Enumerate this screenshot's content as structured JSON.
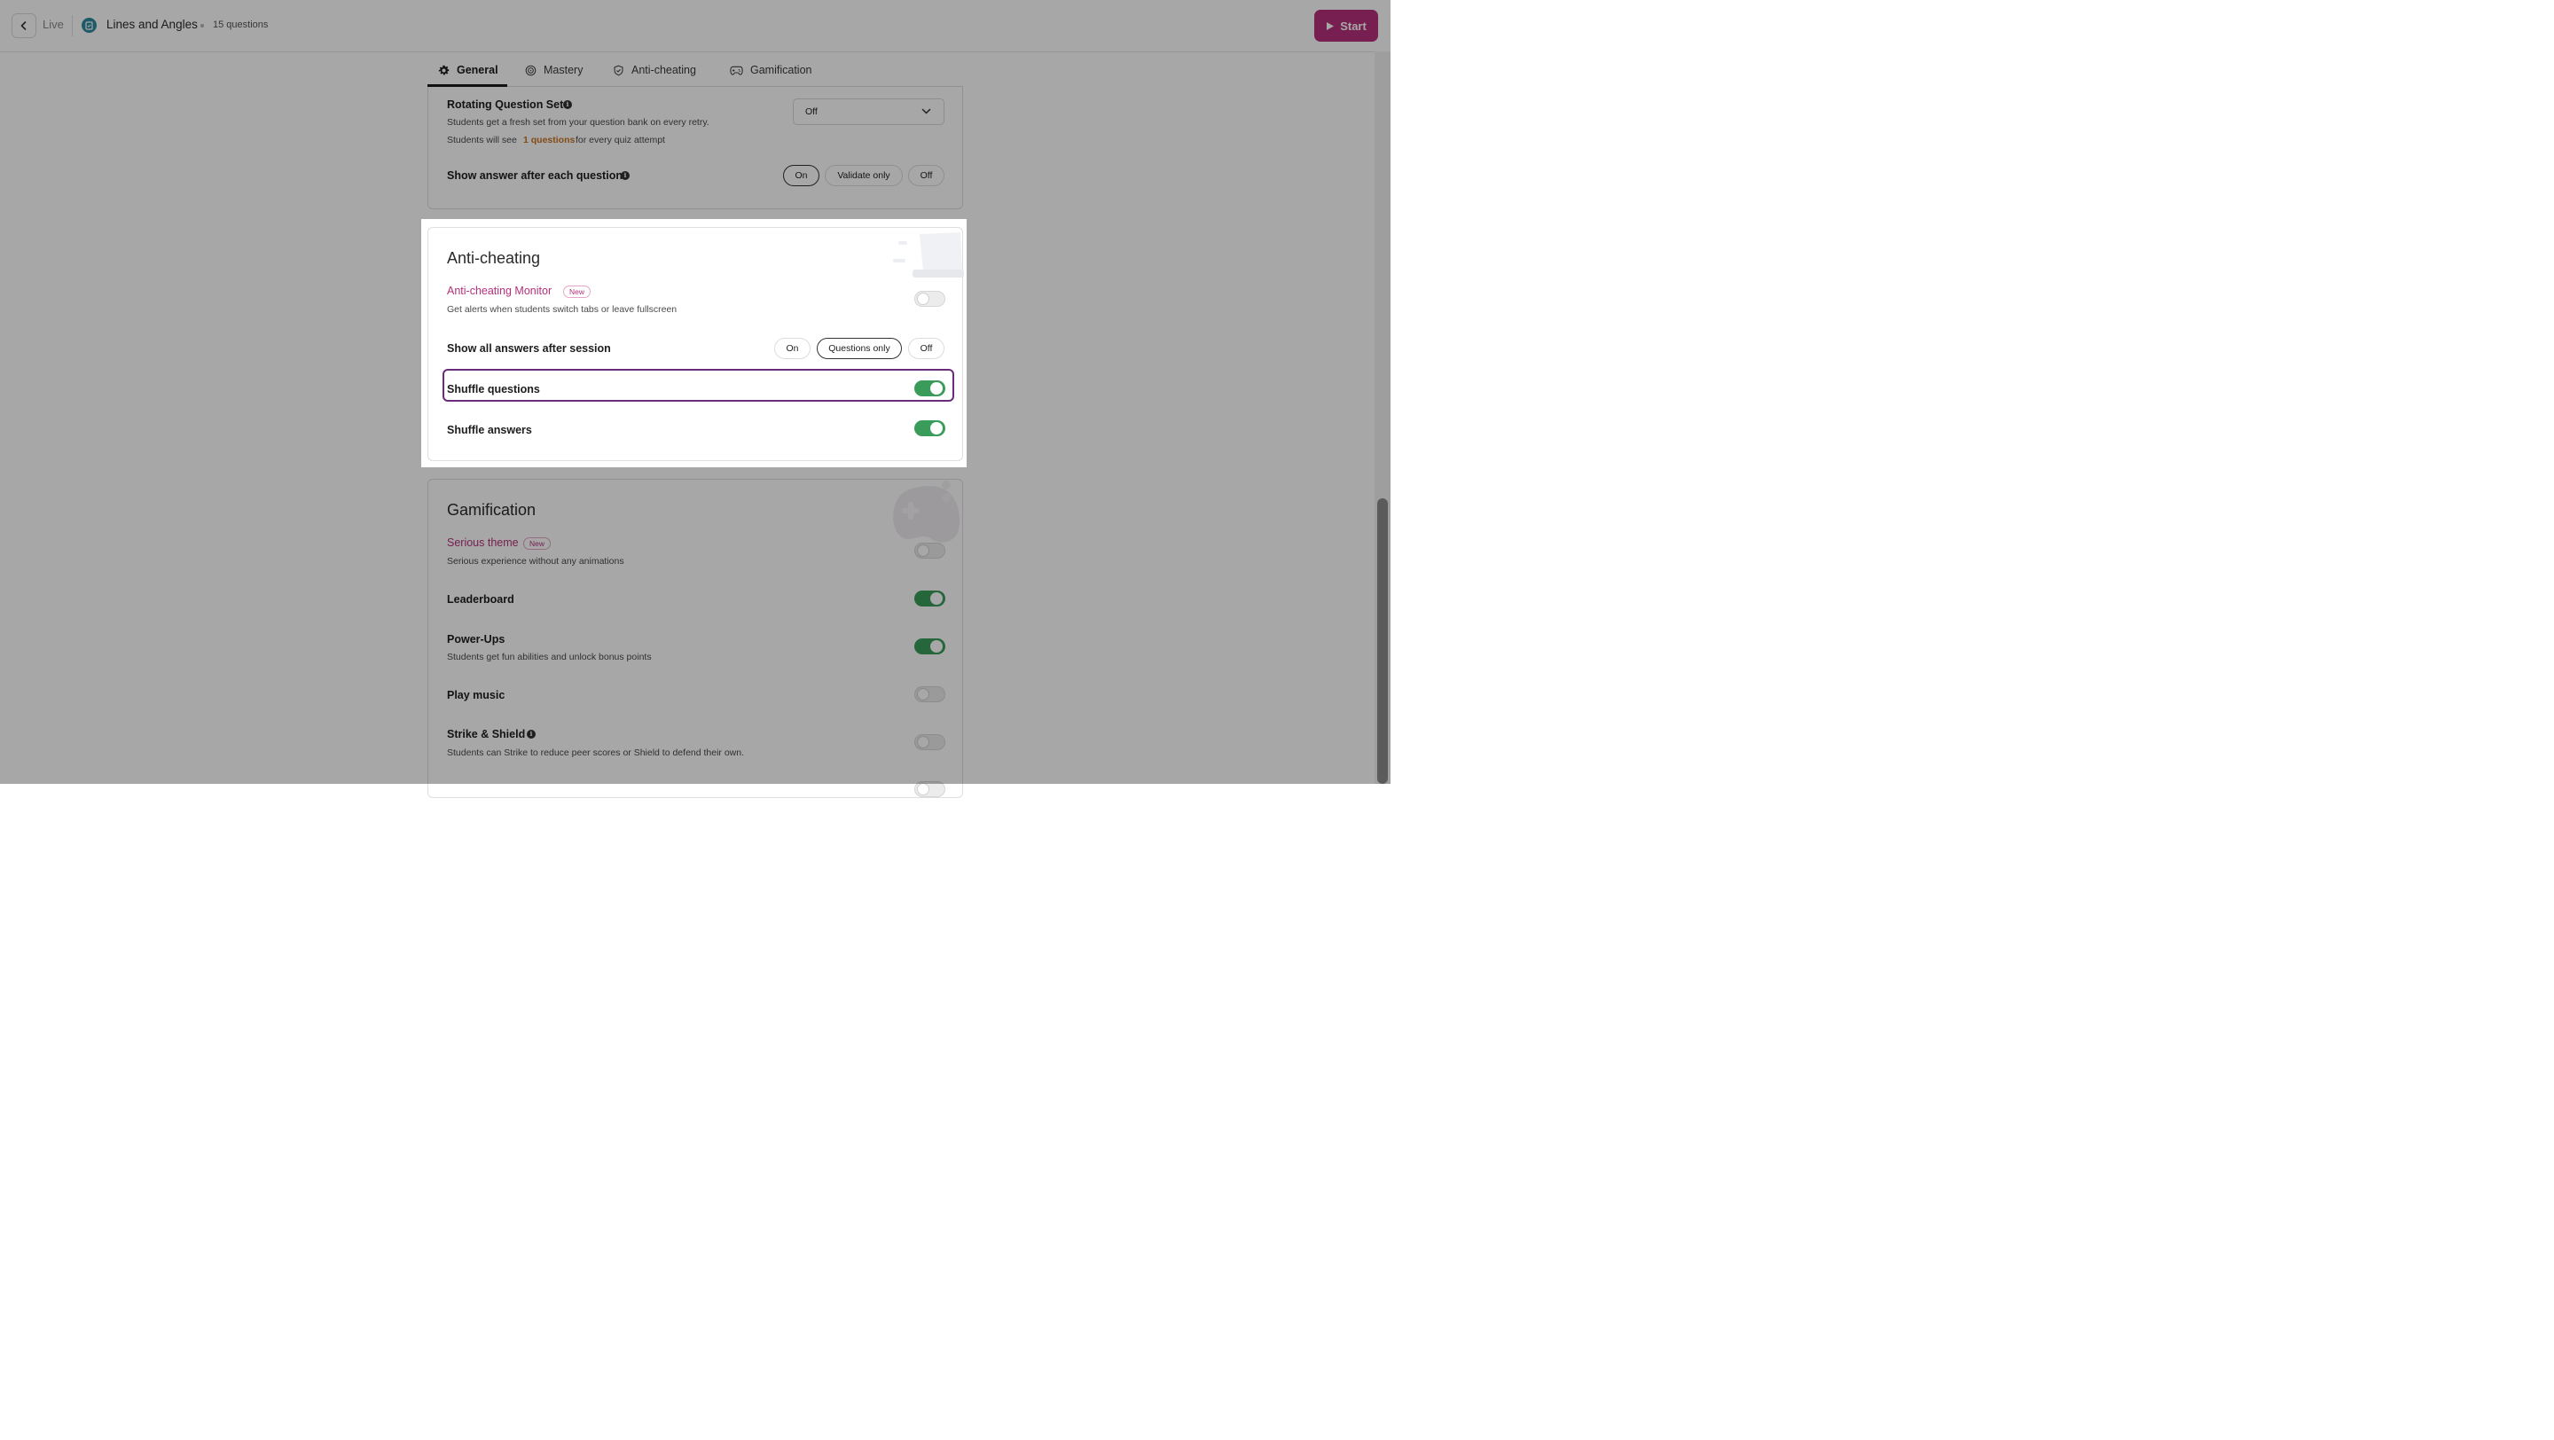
{
  "header": {
    "back_label": "Live",
    "quiz_title": "Lines and Angles",
    "question_count": "15 questions",
    "start_label": "Start"
  },
  "tabs": [
    {
      "label": "General",
      "icon": "gear-icon",
      "active": true
    },
    {
      "label": "Mastery",
      "icon": "target-icon",
      "active": false
    },
    {
      "label": "Anti-cheating",
      "icon": "shield-icon",
      "active": false
    },
    {
      "label": "Gamification",
      "icon": "gamepad-icon",
      "active": false
    }
  ],
  "general": {
    "rotating": {
      "title": "Rotating Question Set",
      "desc": "Students get a fresh set from your question bank on every retry.",
      "see_prefix": "Students will see",
      "see_count": "1 questions",
      "see_suffix": "for every quiz attempt",
      "dropdown_value": "Off"
    },
    "show_answer": {
      "title": "Show answer after each question",
      "options": [
        "On",
        "Validate only",
        "Off"
      ],
      "selected": "On"
    }
  },
  "anti_cheating": {
    "title": "Anti-cheating",
    "monitor": {
      "title": "Anti-cheating Monitor",
      "badge": "New",
      "desc": "Get alerts when students switch tabs or leave fullscreen",
      "enabled": false
    },
    "show_all_answers": {
      "title": "Show all answers after session",
      "options": [
        "On",
        "Questions only",
        "Off"
      ],
      "selected": "Questions only"
    },
    "shuffle_questions": {
      "title": "Shuffle questions",
      "enabled": true
    },
    "shuffle_answers": {
      "title": "Shuffle answers",
      "enabled": true
    }
  },
  "gamification": {
    "title": "Gamification",
    "serious_theme": {
      "title": "Serious theme",
      "badge": "New",
      "desc": "Serious experience without any animations",
      "enabled": false
    },
    "leaderboard": {
      "title": "Leaderboard",
      "enabled": true
    },
    "power_ups": {
      "title": "Power-Ups",
      "desc": "Students get fun abilities and unlock bonus points",
      "enabled": true
    },
    "play_music": {
      "title": "Play music",
      "enabled": false
    },
    "strike_shield": {
      "title": "Strike & Shield",
      "desc": "Students can Strike to reduce peer scores or Shield to defend their own.",
      "enabled": false
    }
  },
  "colors": {
    "brand": "#b4307a",
    "toggle_on": "#3a9c5a",
    "highlight": "#6a2c7a",
    "accent_orange": "#c8731f"
  }
}
